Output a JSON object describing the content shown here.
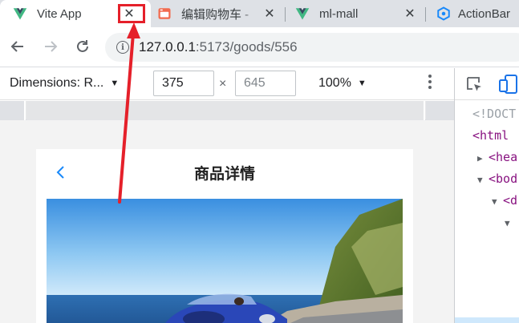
{
  "tabs": [
    {
      "title": "Vite App",
      "active": true,
      "icon": "vue-icon"
    },
    {
      "title": "编辑购物车 - ",
      "active": false,
      "icon": "page-icon"
    },
    {
      "title": "ml-mall",
      "active": false,
      "icon": "vue-icon"
    },
    {
      "title": "ActionBar",
      "active": false,
      "icon": "vant-icon"
    }
  ],
  "tab_close_glyph": "✕",
  "address": {
    "host": "127.0.0.1",
    "rest": ":5173/goods/556"
  },
  "device_toolbar": {
    "dimensions_label": "Dimensions: R...",
    "width_value": "375",
    "height_placeholder": "645",
    "times": "×",
    "zoom": "100%"
  },
  "app": {
    "title": "商品详情",
    "back_icon": "chevron-left-icon"
  },
  "elements_panel": {
    "lines": [
      {
        "text": "<!DOCT",
        "kind": "comment",
        "tri": ""
      },
      {
        "text": "<html",
        "kind": "tag",
        "tri": ""
      },
      {
        "text": "<hea",
        "kind": "tag",
        "tri": "▶"
      },
      {
        "text": "<bod",
        "kind": "tag",
        "tri": "▼"
      },
      {
        "text": "<d",
        "kind": "tag",
        "tri": "▼"
      },
      {
        "text": "",
        "kind": "tag",
        "tri": "▼"
      }
    ]
  },
  "colors": {
    "annotation": "#e5202a",
    "vue_green": "#41b883",
    "vue_dark": "#35495e",
    "link_blue": "#1a73e8"
  }
}
